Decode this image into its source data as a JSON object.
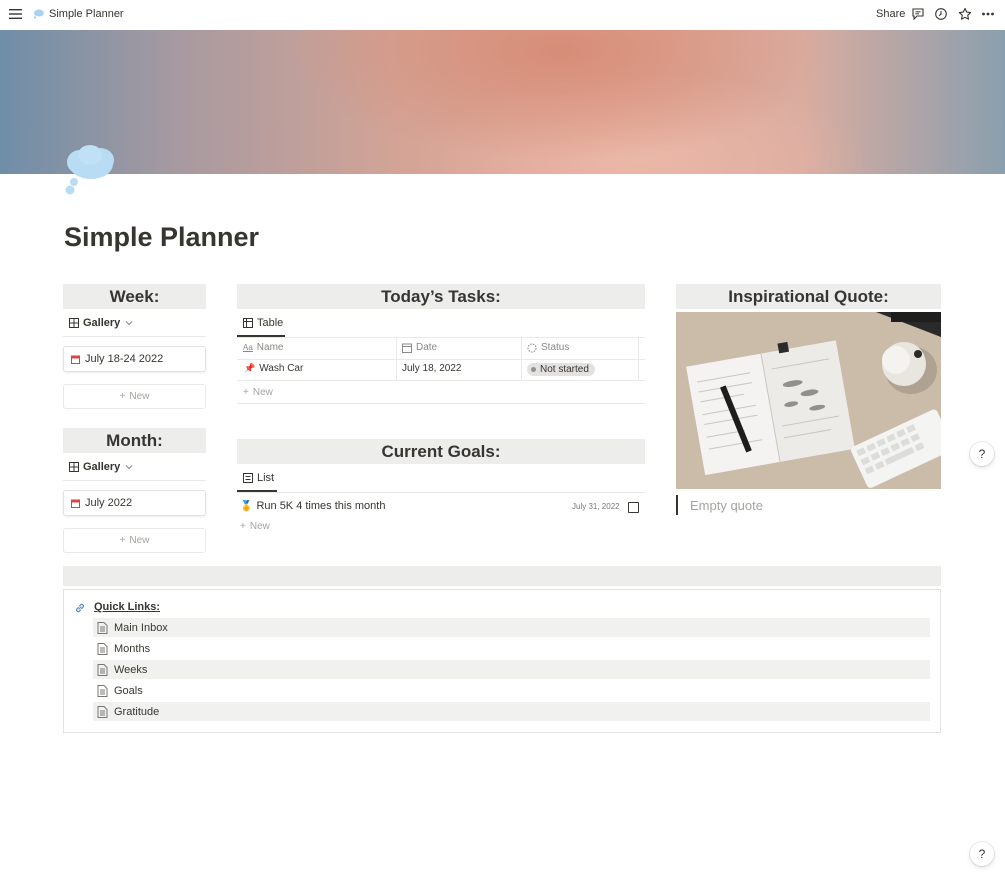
{
  "topbar": {
    "breadcrumb": "Simple Planner",
    "share_label": "Share",
    "icons": [
      "menu-icon",
      "comment-icon",
      "history-icon",
      "star-icon",
      "more-icon"
    ]
  },
  "page": {
    "title": "Simple Planner",
    "icon": "thought-cloud-icon"
  },
  "week": {
    "header": "Week:",
    "view_label": "Gallery",
    "card_label": "July 18-24 2022",
    "new_label": "New"
  },
  "month": {
    "header": "Month:",
    "view_label": "Gallery",
    "card_label": "July 2022",
    "new_label": "New"
  },
  "tasks": {
    "header": "Today’s Tasks:",
    "view_label": "Table",
    "columns": [
      "Name",
      "Date",
      "Status"
    ],
    "rows": [
      {
        "name": "Wash Car",
        "date": "July 18, 2022",
        "status": "Not started"
      }
    ],
    "new_label": "New"
  },
  "goals": {
    "header": "Current Goals:",
    "view_label": "List",
    "items": [
      {
        "title": "Run 5K 4 times this month",
        "date": "July 31, 2022",
        "done": false
      }
    ],
    "new_label": "New"
  },
  "quote": {
    "header": "Inspirational Quote:",
    "placeholder": "Empty quote"
  },
  "quick_links": {
    "title": "Quick Links:",
    "items": [
      "Main Inbox",
      "Months",
      "Weeks",
      "Goals",
      "Gratitude"
    ]
  },
  "help_label": "?",
  "colors": {
    "header_bg": "#ededeb",
    "text": "#37352f",
    "muted": "#a5a4a0"
  }
}
